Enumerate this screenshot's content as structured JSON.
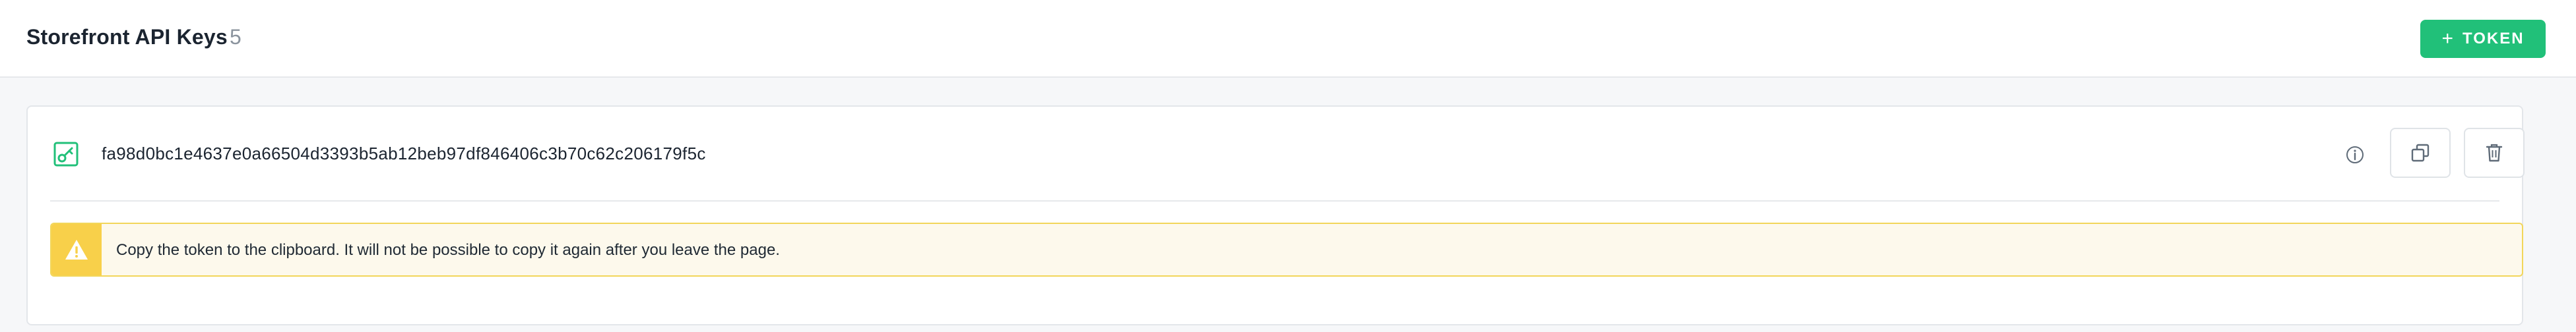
{
  "header": {
    "title": "Storefront API Keys",
    "count": "5",
    "add_button_label": "TOKEN",
    "add_button_plus": "+"
  },
  "token": {
    "value": "fa98d0bc1e4637e0a66504d3393b5ab12beb97df846406c3b70c62c206179f5c",
    "icon": "key-icon",
    "actions": {
      "info_icon": "info-icon",
      "copy_icon": "copy-icon",
      "delete_icon": "trash-icon"
    }
  },
  "warning": {
    "icon": "warning-triangle-icon",
    "message": "Copy the token to the clipboard. It will not be possible to copy it again after you leave the page."
  },
  "colors": {
    "accent": "#21c079",
    "warning_bg": "#fdf9ec",
    "warning_border": "#f2d65a",
    "warning_icon_bg": "#f8d04a"
  }
}
